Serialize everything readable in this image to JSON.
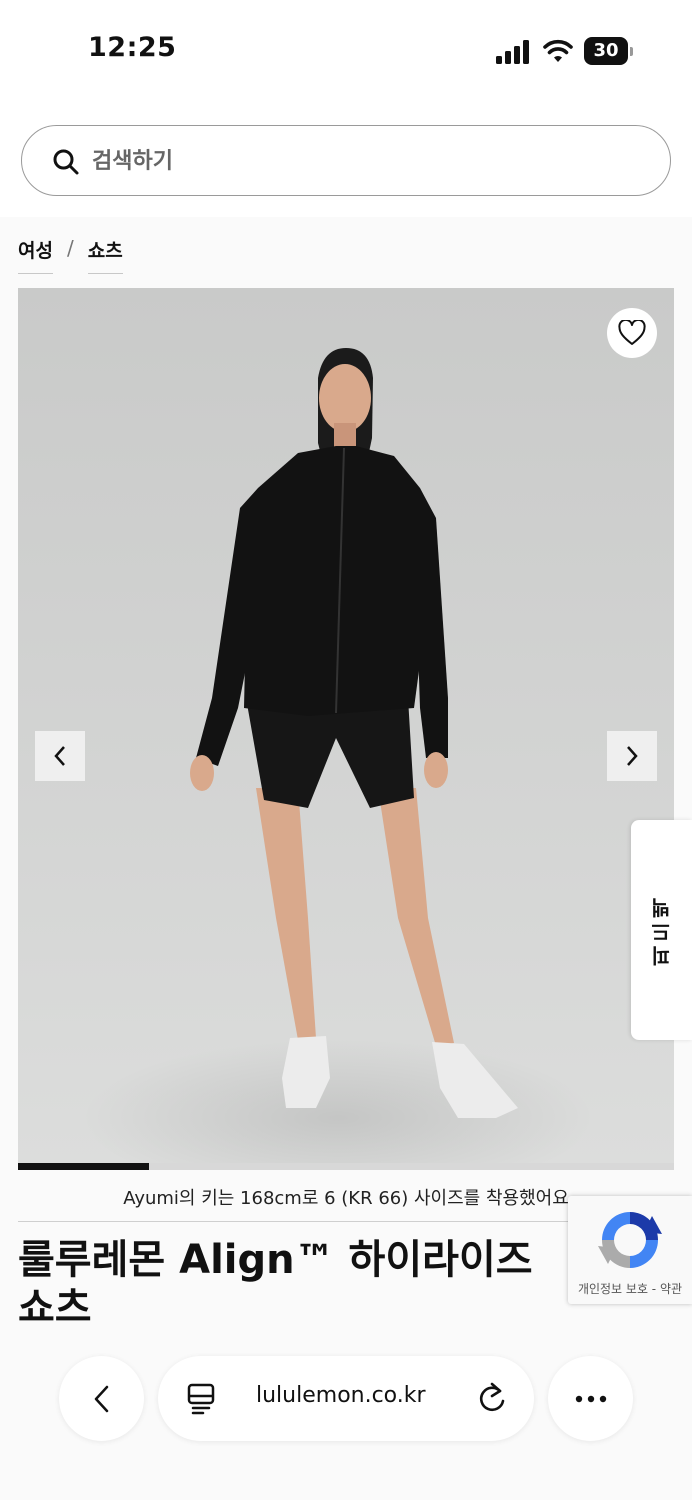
{
  "status_bar": {
    "time": "12:25",
    "battery_percent": "30",
    "icons": [
      "signal-icon",
      "wifi-icon",
      "battery-icon"
    ]
  },
  "search": {
    "placeholder": "검색하기",
    "icon": "search-icon"
  },
  "breadcrumb": {
    "items": [
      "여성",
      "쇼츠"
    ],
    "separator": "/"
  },
  "product": {
    "image_carousel": {
      "progress": 0.2,
      "icons": [
        "heart-icon",
        "chevron-left-icon",
        "chevron-right-icon"
      ]
    },
    "model_caption": "Ayumi의 키는 168cm로 6 (KR 66) 사이즈를 착용했어요",
    "title": "룰루레몬 Align™ 하이라이즈 쇼츠\n4\""
  },
  "feedback_tab": {
    "label": "피드백"
  },
  "recaptcha": {
    "links": "개인정보 보호 - 약관"
  },
  "browser": {
    "url": "lululemon.co.kr",
    "icons": [
      "back-icon",
      "tabs-icon",
      "reload-icon",
      "more-icon"
    ]
  },
  "colors": {
    "text": "#111111",
    "image_background": "#d0d1d0",
    "progress": "#111111"
  }
}
